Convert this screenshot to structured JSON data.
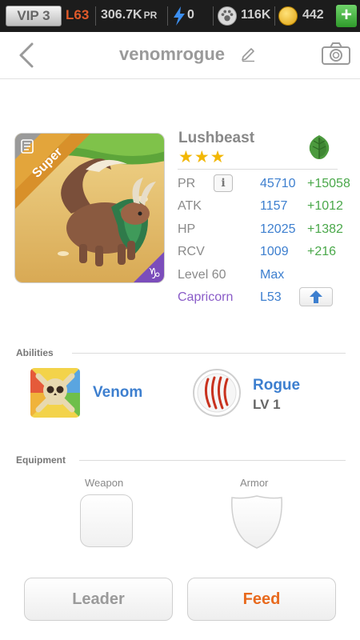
{
  "status_bar": {
    "vip": "VIP 3",
    "level": "L63",
    "pr_value": "306.7K",
    "pr_unit": "PR",
    "energy": "0",
    "food": "116K",
    "gold": "442",
    "add_label": "+"
  },
  "header": {
    "title": "venomrogue"
  },
  "monster": {
    "badge": "Super",
    "name": "Lushbeast",
    "stars": "★★★",
    "element_icon": "leaf-icon",
    "stats": [
      {
        "label": "PR",
        "value": "45710",
        "bonus": "+15058"
      },
      {
        "label": "ATK",
        "value": "1157",
        "bonus": "+1012"
      },
      {
        "label": "HP",
        "value": "12025",
        "bonus": "+1382"
      },
      {
        "label": "RCV",
        "value": "1009",
        "bonus": "+216"
      }
    ],
    "level_label": "Level 60",
    "level_value": "Max",
    "sign_label": "Capricorn",
    "sign_value": "L53"
  },
  "abilities": {
    "heading": "Abilities",
    "items": [
      {
        "name": "Venom",
        "icon": "skull-icon"
      },
      {
        "name": "Rogue",
        "level": "LV 1",
        "icon": "claw-icon"
      }
    ]
  },
  "equipment": {
    "heading": "Equipment",
    "weapon_label": "Weapon",
    "armor_label": "Armor"
  },
  "actions": {
    "leader_label": "Leader",
    "feed_label": "Feed"
  },
  "colors": {
    "accent_blue": "#3d7fcf",
    "bonus_green": "#4aa84a",
    "level_orange": "#e05a2a",
    "feed_orange": "#e86a1e",
    "sign_purple": "#8a5cc8",
    "star_gold": "#f2b705"
  }
}
